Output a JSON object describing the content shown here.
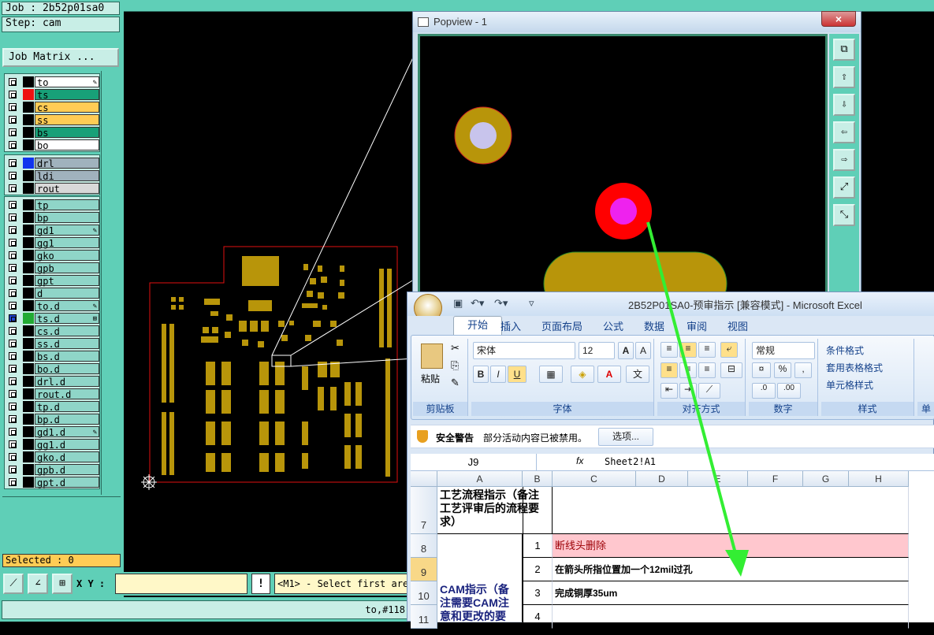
{
  "genesis": {
    "job_label": "Job : 2b52p01sa0",
    "step_label": "Step: cam",
    "job_matrix_button": "Job Matrix ...",
    "layer_groups": [
      [
        {
          "name": "to",
          "color": "#000000",
          "bg": "#ffffff",
          "mark": "✎"
        },
        {
          "name": "ts",
          "color": "#ee1111",
          "bg": "#18a078",
          "mark": ""
        },
        {
          "name": "cs",
          "color": "#000000",
          "bg": "#ffcc55",
          "mark": ""
        },
        {
          "name": "ss",
          "color": "#000000",
          "bg": "#ffcc55",
          "mark": ""
        },
        {
          "name": "bs",
          "color": "#000000",
          "bg": "#18a078",
          "mark": ""
        },
        {
          "name": "bo",
          "color": "#000000",
          "bg": "#ffffff",
          "mark": ""
        }
      ],
      [
        {
          "name": "drl",
          "color": "#1133ee",
          "bg": "#a0b2bd",
          "mark": ""
        },
        {
          "name": "ldi",
          "color": "#000000",
          "bg": "#a0b2bd",
          "mark": ""
        },
        {
          "name": "rout",
          "color": "#000000",
          "bg": "#d8d8d8",
          "mark": ""
        }
      ],
      [
        {
          "name": "tp",
          "color": "#000000",
          "bg": "#8fd5c8",
          "mark": ""
        },
        {
          "name": "bp",
          "color": "#000000",
          "bg": "#8fd5c8",
          "mark": ""
        },
        {
          "name": "gd1",
          "color": "#000000",
          "bg": "#8fd5c8",
          "mark": "✎"
        },
        {
          "name": "gg1",
          "color": "#000000",
          "bg": "#8fd5c8",
          "mark": ""
        },
        {
          "name": "gko",
          "color": "#000000",
          "bg": "#8fd5c8",
          "mark": ""
        },
        {
          "name": "gpb",
          "color": "#000000",
          "bg": "#8fd5c8",
          "mark": ""
        },
        {
          "name": "gpt",
          "color": "#000000",
          "bg": "#8fd5c8",
          "mark": ""
        },
        {
          "name": "d",
          "color": "#000000",
          "bg": "#8fd5c8",
          "mark": ""
        },
        {
          "name": "to.d",
          "color": "#000000",
          "bg": "#8fd5c8",
          "mark": "✎"
        },
        {
          "name": "ts.d",
          "color": "#22aa33",
          "bg": "#8fd5c8",
          "mark": "⊞",
          "active": true
        },
        {
          "name": "cs.d",
          "color": "#000000",
          "bg": "#8fd5c8",
          "mark": ""
        },
        {
          "name": "ss.d",
          "color": "#000000",
          "bg": "#8fd5c8",
          "mark": ""
        },
        {
          "name": "bs.d",
          "color": "#000000",
          "bg": "#8fd5c8",
          "mark": ""
        },
        {
          "name": "bo.d",
          "color": "#000000",
          "bg": "#8fd5c8",
          "mark": ""
        },
        {
          "name": "drl.d",
          "color": "#000000",
          "bg": "#8fd5c8",
          "mark": ""
        },
        {
          "name": "rout.d",
          "color": "#000000",
          "bg": "#8fd5c8",
          "mark": ""
        },
        {
          "name": "tp.d",
          "color": "#000000",
          "bg": "#8fd5c8",
          "mark": ""
        },
        {
          "name": "bp.d",
          "color": "#000000",
          "bg": "#8fd5c8",
          "mark": ""
        },
        {
          "name": "gd1.d",
          "color": "#000000",
          "bg": "#8fd5c8",
          "mark": "✎"
        },
        {
          "name": "gg1.d",
          "color": "#000000",
          "bg": "#8fd5c8",
          "mark": ""
        },
        {
          "name": "gko.d",
          "color": "#000000",
          "bg": "#8fd5c8",
          "mark": ""
        },
        {
          "name": "gpb.d",
          "color": "#000000",
          "bg": "#8fd5c8",
          "mark": ""
        },
        {
          "name": "gpt.d",
          "color": "#000000",
          "bg": "#8fd5c8",
          "mark": ""
        }
      ]
    ],
    "selected_label": "Selected : 0",
    "xy_label": "X Y :",
    "xy_value": "",
    "exclaim": "!",
    "message": "<M1> - Select first are",
    "status": "to,#118"
  },
  "popview": {
    "title": "Popview - 1",
    "close": "×",
    "tools": [
      "⧉",
      "⇧",
      "⇩",
      "⇦",
      "⇨",
      "⤢",
      "⤡"
    ]
  },
  "excel": {
    "title": "2B52P01SA0-预审指示  [兼容模式] - Microsoft Excel",
    "tabs": [
      "开始",
      "插入",
      "页面布局",
      "公式",
      "数据",
      "审阅",
      "视图"
    ],
    "groups": {
      "clipboard": "剪贴板",
      "font": "字体",
      "alignment": "对齐方式",
      "number": "数字",
      "styles": "样式",
      "cells": "单"
    },
    "paste": "粘贴",
    "font_name": "宋体",
    "font_size": "12",
    "number_format": "常规",
    "style_buttons": [
      "条件格式",
      "套用表格格式",
      "单元格样式"
    ],
    "security_title": "安全警告",
    "security_msg": "部分活动内容已被禁用。",
    "options_button": "选项...",
    "namebox": "J9",
    "fx": "fx",
    "formula": "Sheet2!A1",
    "columns": [
      "A",
      "B",
      "C",
      "D",
      "E",
      "F",
      "G",
      "H"
    ],
    "rows": [
      {
        "num": "7",
        "a": "工艺流程指示（备注工艺评审后的流程要求）",
        "b": "",
        "c": ""
      },
      {
        "num": "8",
        "a": "",
        "b": "1",
        "c": "断线头删除"
      },
      {
        "num": "9",
        "a": "",
        "b": "2",
        "c": "在箭头所指位置加一个12mil过孔"
      },
      {
        "num": "10",
        "a": "CAM指示（备注需要CAM注意和更改的要",
        "b": "3",
        "c": "完成铜厚35um"
      },
      {
        "num": "11",
        "a": "",
        "b": "4",
        "c": ""
      }
    ]
  },
  "colors": {
    "genesis_teal": "#5fcfb7",
    "pad_gold": "#b8950a",
    "arrow_green": "#33ee33",
    "highlight_red": "#ff0000",
    "highlight_magenta": "#ee22ee"
  }
}
